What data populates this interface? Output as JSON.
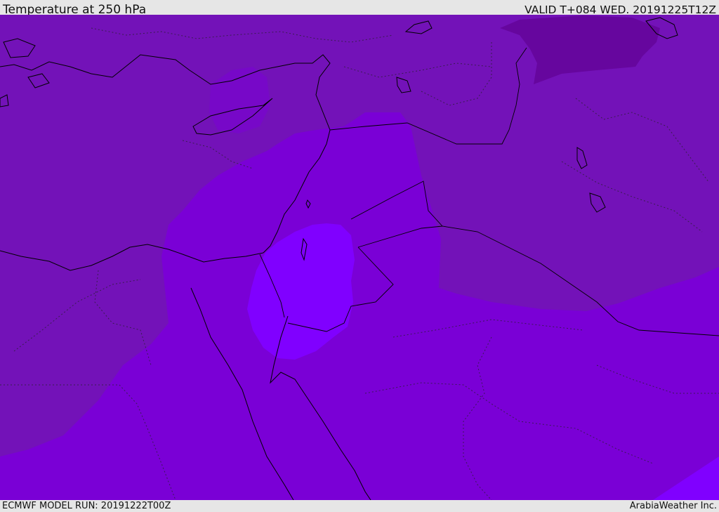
{
  "header": {
    "title": "Temperature at 250 hPa",
    "valid": "VALID T+084 WED. 20191225T12Z"
  },
  "footer": {
    "model_run": "ECMWF MODEL RUN: 20191222T00Z",
    "credit": "ArabiaWeather Inc."
  },
  "map": {
    "region": "Eastern Mediterranean / Middle East",
    "colors": {
      "background_band": "#7a00d6",
      "cold_band": "#7312b8",
      "coldest_band": "#66069e",
      "warm_band": "#8000ff",
      "coastline": "#000000"
    }
  }
}
